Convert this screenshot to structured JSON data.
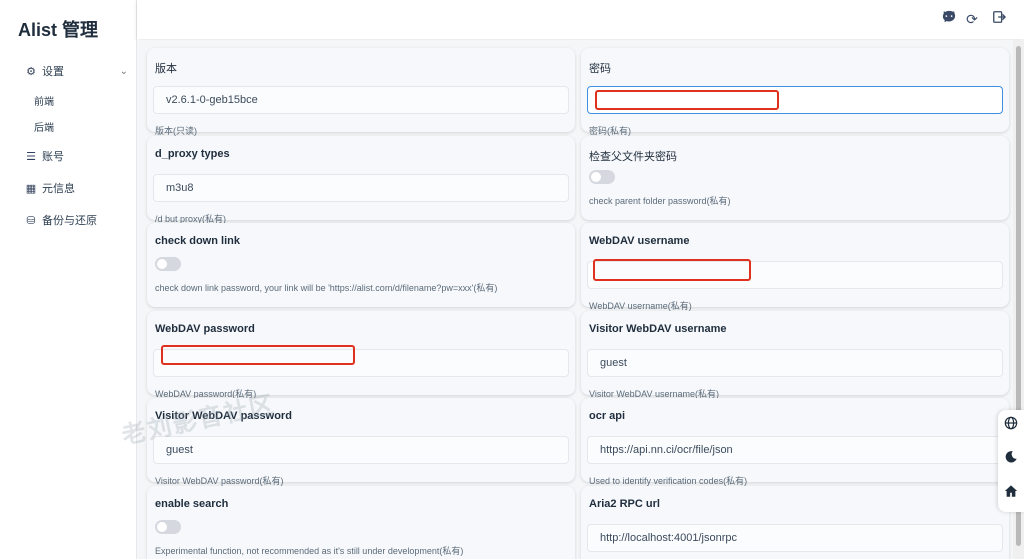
{
  "brand": "Alist 管理",
  "sidebar": {
    "settings": "设置",
    "frontend": "前端",
    "backend": "后端",
    "accounts": "账号",
    "meta": "元信息",
    "backup": "备份与还原"
  },
  "cards": {
    "version": {
      "label": "版本",
      "value": "v2.6.1-0-geb15bce",
      "help": "版本(只读)"
    },
    "password": {
      "label": "密码",
      "value": "",
      "help": "密码(私有)"
    },
    "d_proxy_types": {
      "label": "d_proxy types",
      "value": "m3u8",
      "help": "/d but proxy(私有)"
    },
    "check_parent": {
      "label": "检查父文件夹密码",
      "help": "check parent folder password(私有)"
    },
    "check_down": {
      "label": "check down link",
      "help": "check down link password, your link will be 'https://alist.com/d/filename?pw=xxx'(私有)"
    },
    "webdav_user": {
      "label": "WebDAV username",
      "value": "",
      "help": "WebDAV username(私有)"
    },
    "webdav_pass": {
      "label": "WebDAV password",
      "value": "",
      "help": "WebDAV password(私有)"
    },
    "visitor_user": {
      "label": "Visitor WebDAV username",
      "value": "guest",
      "help": "Visitor WebDAV username(私有)"
    },
    "visitor_pass": {
      "label": "Visitor WebDAV password",
      "value": "guest",
      "help": "Visitor WebDAV password(私有)"
    },
    "ocr_api": {
      "label": "ocr api",
      "value": "https://api.nn.ci/ocr/file/json",
      "help": "Used to identify verification codes(私有)"
    },
    "enable_search": {
      "label": "enable search",
      "help": "Experimental function, not recommended as it's still under development(私有)"
    },
    "aria2_url": {
      "label": "Aria2 RPC url",
      "value": "http://localhost:4001/jsonrpc"
    }
  },
  "watermark": "老刘影音社区"
}
